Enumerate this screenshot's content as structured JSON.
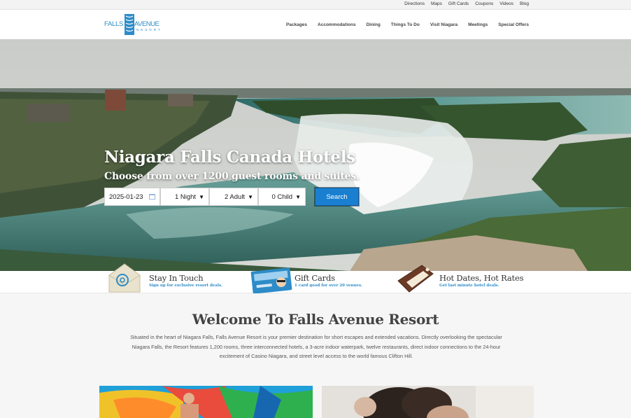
{
  "utility_nav": [
    "Directions",
    "Maps",
    "Gift Cards",
    "Coupons",
    "Videos",
    "Blog"
  ],
  "logo": {
    "falls": "FALLS",
    "avenue": "AVENUE",
    "resort": "RESORT"
  },
  "main_nav": [
    "Packages",
    "Accommodations",
    "Dining",
    "Things To Do",
    "Visit Niagara",
    "Meetings",
    "Special Offers"
  ],
  "hero": {
    "title": "Niagara Falls Canada Hotels",
    "subtitle": "Choose from over 1200 guest rooms and suites."
  },
  "booking": {
    "date": "2025-01-23",
    "nights": "1 Night",
    "adults": "2 Adult",
    "children": "0 Child",
    "search_label": "Search",
    "dropdown_arrow": "▼"
  },
  "promos": [
    {
      "title": "Stay In Touch",
      "desc": "Sign up for exclusive resort deals.",
      "icon": "envelope-at-icon"
    },
    {
      "title": "Gift Cards",
      "desc": "1 card good for over 20 venues.",
      "icon": "gift-card-icon"
    },
    {
      "title": "Hot Dates, Hot Rates",
      "desc": "Get last minute hotel deals.",
      "icon": "luggage-tag-icon"
    }
  ],
  "welcome": {
    "title": "Welcome To Falls Avenue Resort",
    "text": "Situated in the heart of Niagara Falls, Falls Avenue Resort is your premier destination for short escapes and extended vacations. Directly overlooking the spectacular Niagara Falls, the Resort features 1,200 rooms, three interconnected hotels, a 3-acre indoor waterpark, twelve restaurants, direct indoor connections to the 24-hour excitement of Casino Niagara, and street level access to the world famous Clifton Hill."
  },
  "colors": {
    "accent": "#2d8cc8",
    "search_button": "#1a7fd0"
  }
}
